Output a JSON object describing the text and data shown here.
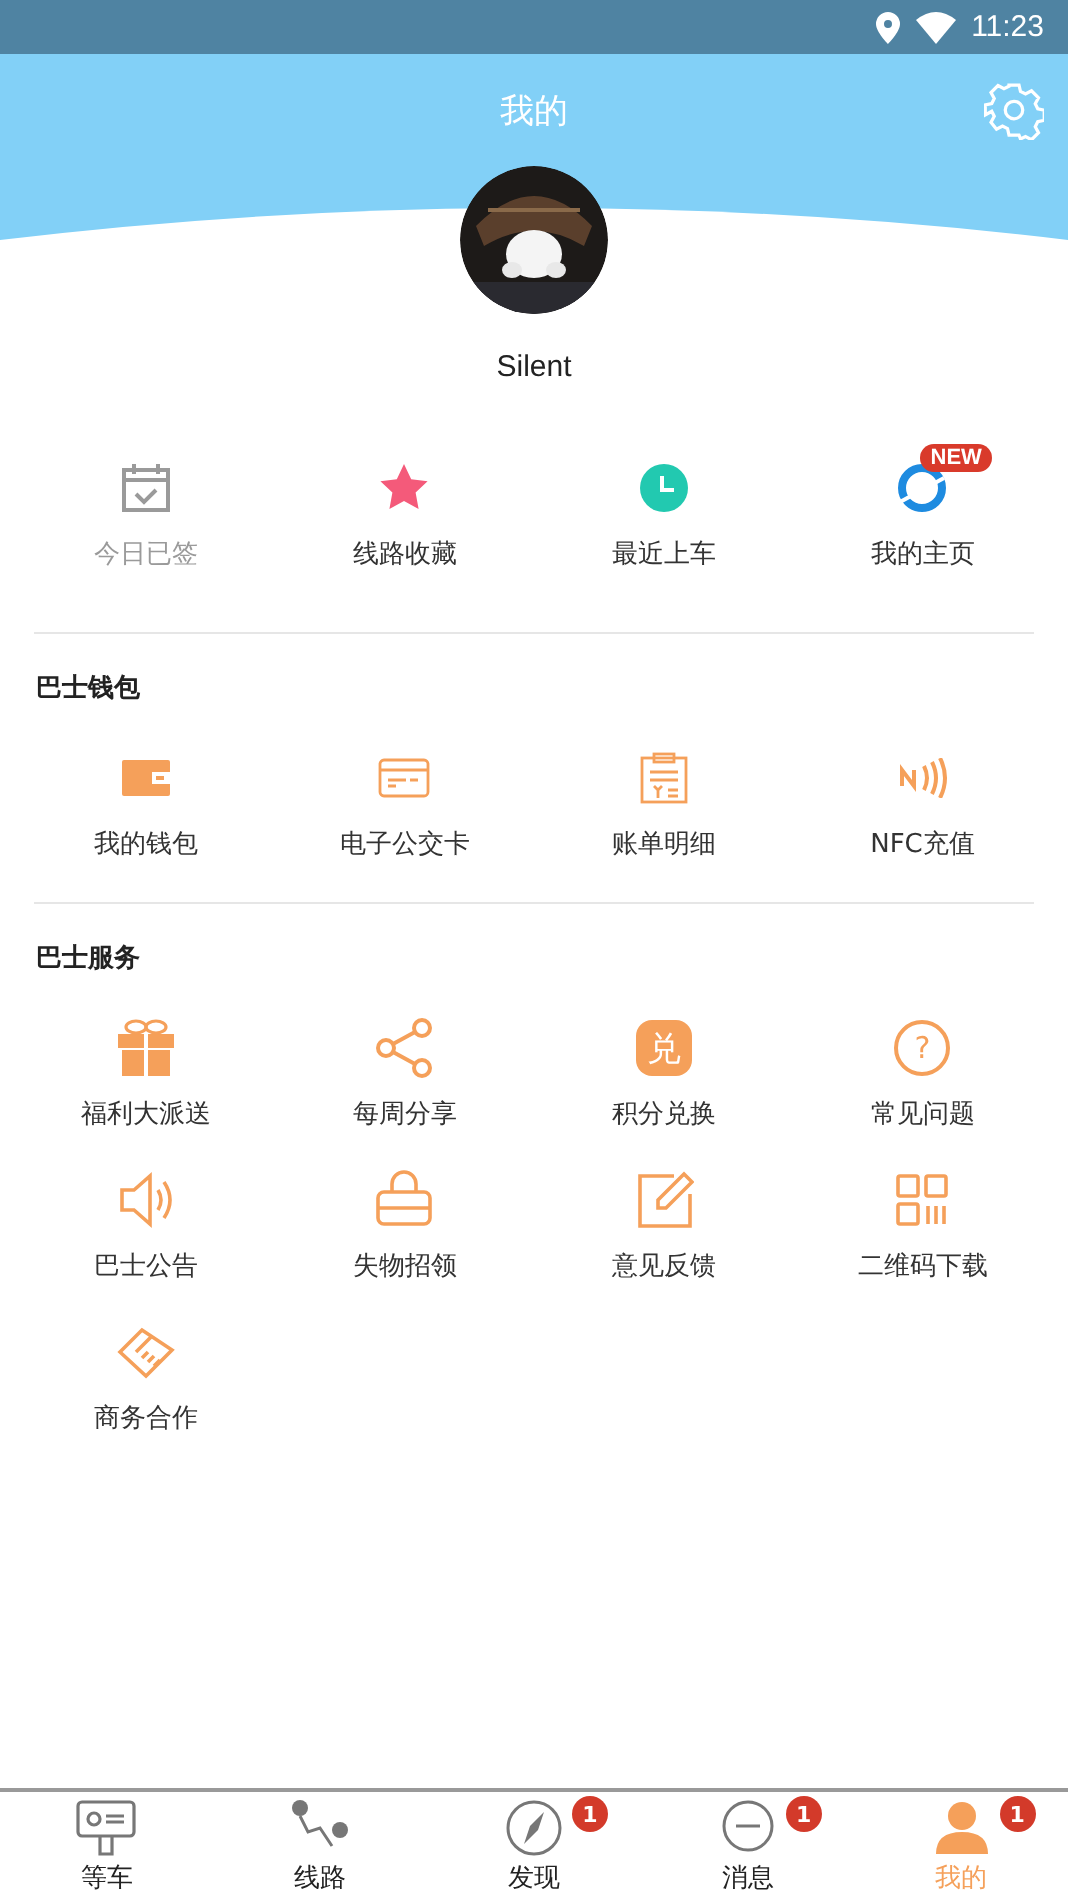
{
  "status_bar": {
    "time": "11:23"
  },
  "header": {
    "title": "我的"
  },
  "profile": {
    "name": "Silent"
  },
  "quick_actions": [
    {
      "label": "今日已签",
      "disabled": true
    },
    {
      "label": "线路收藏",
      "disabled": false
    },
    {
      "label": "最近上车",
      "disabled": false
    },
    {
      "label": "我的主页",
      "disabled": false,
      "badge": "NEW"
    }
  ],
  "sections": [
    {
      "title": "巴士钱包",
      "items": [
        {
          "label": "我的钱包"
        },
        {
          "label": "电子公交卡"
        },
        {
          "label": "账单明细"
        },
        {
          "label": "NFC充值"
        }
      ]
    },
    {
      "title": "巴士服务",
      "items": [
        {
          "label": "福利大派送"
        },
        {
          "label": "每周分享"
        },
        {
          "label": "积分兑换",
          "icon_text": "兑"
        },
        {
          "label": "常见问题",
          "icon_text": "?"
        },
        {
          "label": "巴士公告"
        },
        {
          "label": "失物招领"
        },
        {
          "label": "意见反馈"
        },
        {
          "label": "二维码下载"
        },
        {
          "label": "商务合作"
        }
      ]
    }
  ],
  "tab_bar": [
    {
      "label": "等车",
      "selected": false
    },
    {
      "label": "线路",
      "selected": false
    },
    {
      "label": "发现",
      "selected": false,
      "badge": "1"
    },
    {
      "label": "消息",
      "selected": false,
      "badge": "1"
    },
    {
      "label": "我的",
      "selected": true,
      "badge": "1"
    }
  ]
}
